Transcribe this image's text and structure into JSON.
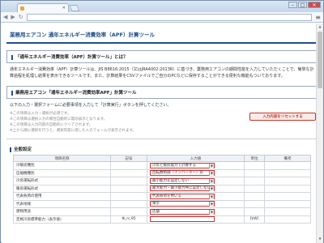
{
  "browser": {
    "tab_title": "",
    "url": "",
    "window_controls": [
      "–",
      "□",
      "✕"
    ]
  },
  "page": {
    "title": "業務用エアコン 通年エネルギー消費効率（APF）計算ツール",
    "section1": {
      "heading": "「通年エネルギー消費効率（APF）計算ツール」とは？",
      "body": "通年エネルギー消費効率（APF）計算ツールは、JIS B8616:2015（又はJRA4002:2013R）に基づき、業務用エアコンの期間性能を入力していただくことで、簡単な計算過程を処理し結果を表示できるツールです。また、計算結果をCSVファイルでご自分のPCなどに保存することができる便利な機能もついております。"
    },
    "section2": {
      "heading": "業務用エアコン「通年エネルギー消費効率APF」計算ツール",
      "instruction": "以下の入力・選択フォームに必要事項を入力して「計算実行」ボタンを押してください。",
      "notes": [
        "※この項目は入力・選択が必須です。",
        "※この項目は選択入力の場合自動的に無効表示となります。",
        "※この項目は入力内容の自動的にクリアされます。",
        "※上から順に選択を行うと、選択内容に適した入力フォームが表示されます。"
      ],
      "reset_button": "入力内容をリセットする"
    },
    "basic_settings": {
      "heading": "全般設定",
      "columns": [
        "項目名称",
        "記号",
        "入力値",
        "単位",
        "備考"
      ],
      "rows": [
        {
          "name": "冷暖房種別",
          "symbol": "",
          "value": "冷房と暖房能力で計算する",
          "unit": "",
          "type": "select"
        },
        {
          "name": "圧縮機種別",
          "symbol": "",
          "value": "回転数制御（インバーター）形",
          "unit": "",
          "type": "select"
        },
        {
          "name": "冷房運転形式",
          "symbol": "",
          "value": "最小能力を設定しない",
          "unit": "",
          "type": "select"
        },
        {
          "name": "暖房運転形式",
          "symbol": "",
          "value": "最大能力・最小能力共に設定しない",
          "unit": "",
          "type": "select"
        },
        {
          "name": "代表負荷の使用",
          "symbol": "",
          "value": "代表負荷を用いる",
          "unit": "",
          "type": "select"
        },
        {
          "name": "代表地域",
          "symbol": "",
          "value": "東京",
          "unit": "",
          "type": "select"
        },
        {
          "name": "建物用途",
          "symbol": "",
          "value": "店舗",
          "unit": "",
          "type": "select"
        },
        {
          "name": "定格冷房標準能力（表示値）",
          "symbol": "Φ_rc,95",
          "value": "",
          "unit": "[kW]",
          "type": "select-partial"
        }
      ]
    }
  }
}
